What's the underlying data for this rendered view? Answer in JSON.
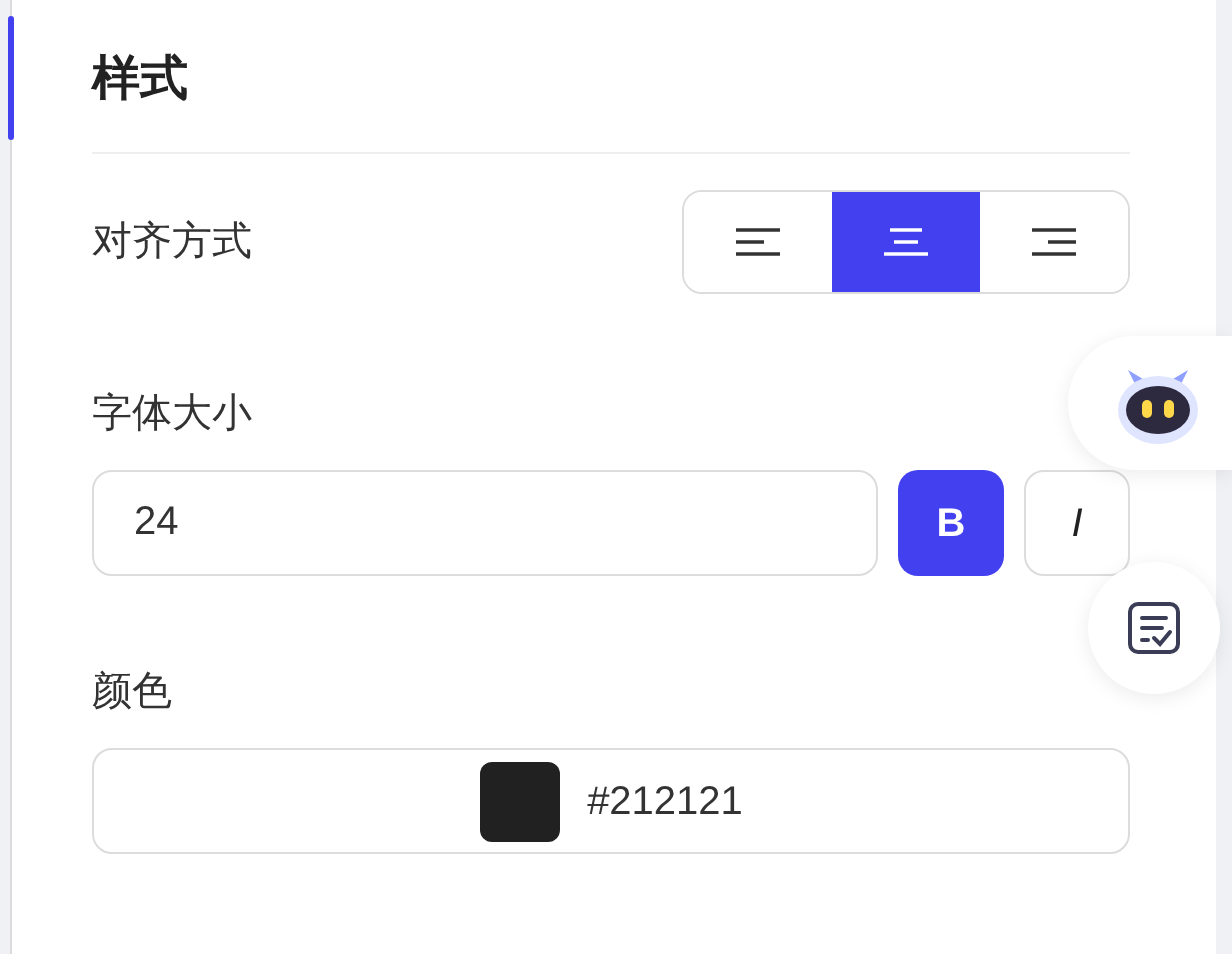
{
  "section": {
    "title": "样式",
    "active": true
  },
  "alignment": {
    "label": "对齐方式",
    "options": [
      {
        "kind": "left",
        "selected": false
      },
      {
        "kind": "center",
        "selected": true
      },
      {
        "kind": "right",
        "selected": false
      }
    ]
  },
  "font_size": {
    "label": "字体大小",
    "value": "24",
    "styles": [
      {
        "label": "B",
        "kind": "bold",
        "selected": true
      },
      {
        "label": "I",
        "kind": "italic",
        "selected": false
      }
    ]
  },
  "color": {
    "label": "颜色",
    "value": "#212121",
    "color": "#212121"
  }
}
